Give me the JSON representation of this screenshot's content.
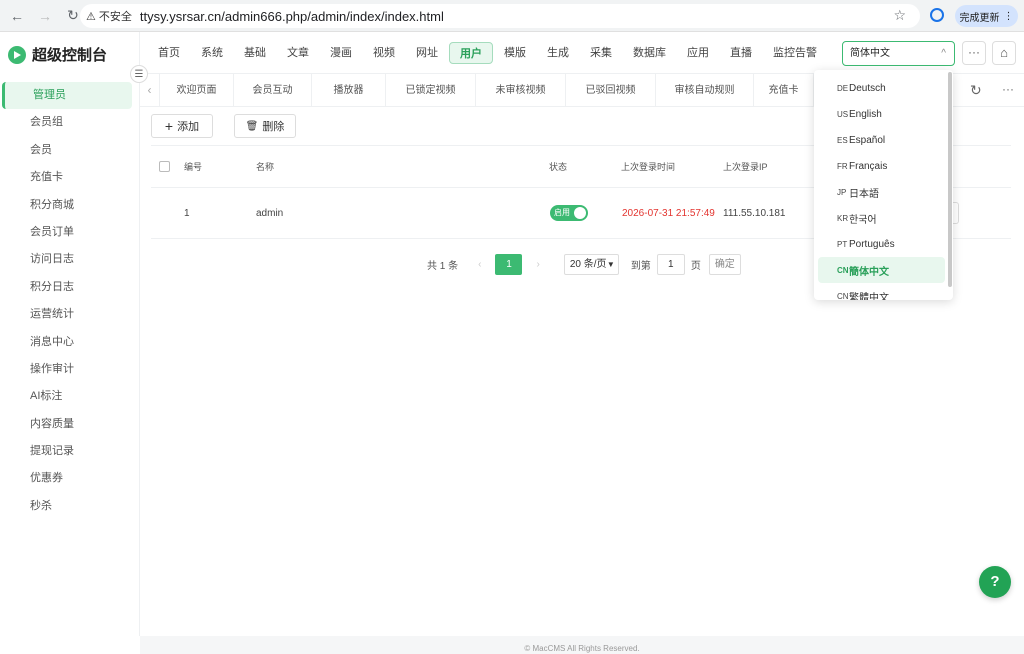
{
  "browser": {
    "insecure_label": "不安全",
    "url": "ttysy.ysrsar.cn/admin666.php/admin/index/index.html",
    "update_label": "完成更新"
  },
  "brand": {
    "title": "超级控制台"
  },
  "sidebar": {
    "items": [
      {
        "label": "管理员",
        "active": true
      },
      {
        "label": "会员组"
      },
      {
        "label": "会员"
      },
      {
        "label": "充值卡"
      },
      {
        "label": "积分商城"
      },
      {
        "label": "会员订单"
      },
      {
        "label": "访问日志"
      },
      {
        "label": "积分日志"
      },
      {
        "label": "运营统计"
      },
      {
        "label": "消息中心"
      },
      {
        "label": "操作审计"
      },
      {
        "label": "AI标注"
      },
      {
        "label": "内容质量"
      },
      {
        "label": "提现记录"
      },
      {
        "label": "优惠券"
      },
      {
        "label": "秒杀"
      }
    ]
  },
  "topnav": {
    "items": [
      "首页",
      "系统",
      "基础",
      "文章",
      "漫画",
      "视频",
      "网址",
      "用户",
      "模版",
      "生成",
      "采集",
      "数据库",
      "应用",
      "直播",
      "监控告警"
    ],
    "active_index": 7,
    "lang_select": "简体中文"
  },
  "tabs": [
    "欢迎页面",
    "会员互动",
    "播放器",
    "已锁定视频",
    "未审核视频",
    "已驳回视频",
    "审核自动规则",
    "充值卡"
  ],
  "toolbar": {
    "add_label": "添加",
    "delete_label": "删除"
  },
  "table": {
    "headers": {
      "id": "编号",
      "name": "名称",
      "status": "状态",
      "last_login": "上次登录时间",
      "last_ip": "上次登录IP"
    },
    "rows": [
      {
        "id": "1",
        "name": "admin",
        "status": "启用",
        "last_login": "2026-07-31 21:57:49",
        "last_ip": "111.55.10.181"
      }
    ]
  },
  "pager": {
    "total": "共 1 条",
    "current": "1",
    "page_size": "20 条/页",
    "goto_label": "到第",
    "goto_value": "1",
    "page_unit": "页",
    "confirm": "确定"
  },
  "languages": [
    {
      "code": "DE",
      "label": "Deutsch"
    },
    {
      "code": "US",
      "label": "English"
    },
    {
      "code": "ES",
      "label": "Español"
    },
    {
      "code": "FR",
      "label": "Français"
    },
    {
      "code": "JP",
      "label": "日本語"
    },
    {
      "code": "KR",
      "label": "한국어"
    },
    {
      "code": "PT",
      "label": "Português"
    },
    {
      "code": "CN",
      "label": "簡体中文",
      "active": true
    },
    {
      "code": "CN",
      "label": "繁體中文"
    }
  ],
  "footer": {
    "copyright": "© MacCMS All Rights Reserved."
  },
  "help": {
    "label": "?"
  },
  "colors": {
    "accent": "#3cba72",
    "accent_light": "#e8f7ee",
    "danger": "#e3342f"
  }
}
